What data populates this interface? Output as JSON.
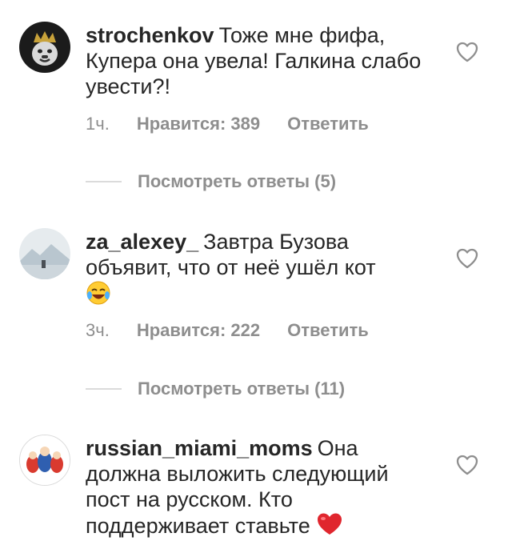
{
  "comments": [
    {
      "username": "strochenkov",
      "text": "Тоже мне фифа, Купера она увела! Галкина слабо увести?!",
      "time": "1ч.",
      "likes": "Нравится: 389",
      "reply": "Ответить",
      "view_replies": "Посмотреть ответы (5)"
    },
    {
      "username": "za_alexey_",
      "text": "Завтра Бузова объявит, что от неё ушёл кот",
      "emoji": "😂",
      "time": "3ч.",
      "likes": "Нравится: 222",
      "reply": "Ответить",
      "view_replies": "Посмотреть ответы (11)"
    },
    {
      "username": "russian_miami_moms",
      "text": "Она должна выложить следующий пост на русском. Кто поддерживает ставьте",
      "emoji": "❤️"
    }
  ],
  "icons": {
    "like": "heart-outline-icon",
    "laugh_emoji": "face-with-tears-of-joy",
    "heart_emoji": "red-heart"
  },
  "colors": {
    "text": "#262626",
    "secondary": "#8e8e8e",
    "divider": "#dbdbdb",
    "heart_red": "#e0262e"
  }
}
